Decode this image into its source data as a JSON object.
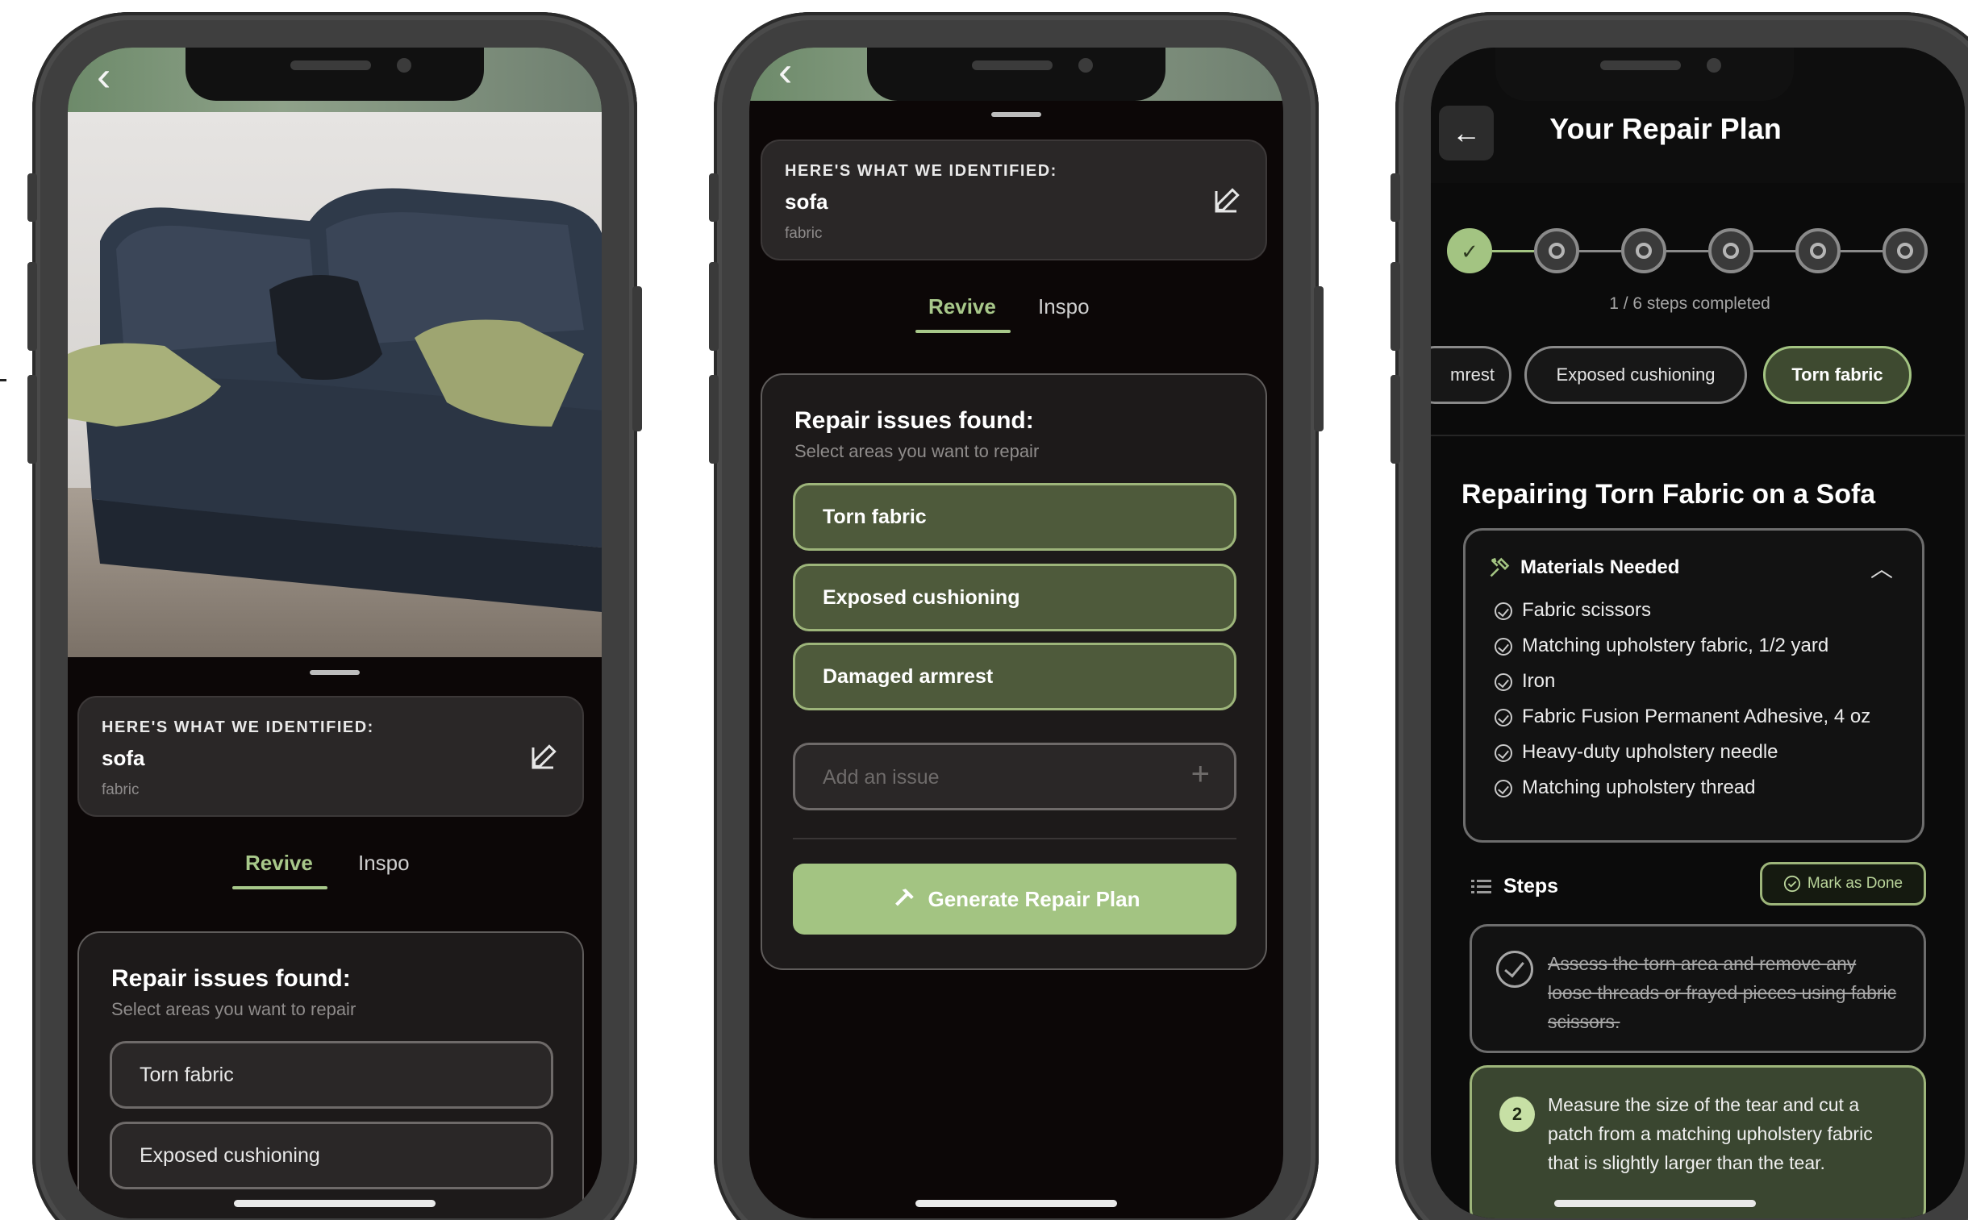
{
  "colors": {
    "accent": "#a3c482",
    "selected_chip": "#4e5a3b",
    "card": "#2a2727",
    "screen_bg": "#0c0707"
  },
  "phone1": {
    "photo_alt_icon": "back-chevron-icon",
    "identified": {
      "heading": "HERE'S WHAT WE IDENTIFIED:",
      "name": "sofa",
      "material": "fabric"
    },
    "tabs": [
      "Revive",
      "Inspo"
    ],
    "issues": {
      "title": "Repair issues found:",
      "subtitle": "Select areas you want to repair",
      "items": [
        "Torn fabric",
        "Exposed cushioning"
      ]
    }
  },
  "phone2": {
    "identified": {
      "heading": "HERE'S WHAT WE IDENTIFIED:",
      "name": "sofa",
      "material": "fabric"
    },
    "tabs": [
      "Revive",
      "Inspo"
    ],
    "issues": {
      "title": "Repair issues found:",
      "subtitle": "Select areas you want to repair",
      "items": [
        "Torn fabric",
        "Exposed cushioning",
        "Damaged armrest"
      ],
      "add_placeholder": "Add an issue",
      "add_symbol": "+"
    },
    "generate_button": "Generate Repair Plan"
  },
  "phone3": {
    "title": "Your Repair Plan",
    "back_symbol": "←",
    "progress": {
      "completed": 1,
      "total": 6,
      "label": "1 / 6 steps completed"
    },
    "chips": [
      "mrest",
      "Exposed cushioning",
      "Torn fabric"
    ],
    "active_chip": "Torn fabric",
    "repair_title": "Repairing Torn Fabric on a Sofa",
    "materials": {
      "heading": "Materials Needed",
      "items": [
        "Fabric scissors",
        "Matching upholstery fabric, 1/2 yard",
        "Iron",
        "Fabric Fusion Permanent Adhesive, 4 oz",
        "Heavy-duty upholstery needle",
        "Matching upholstery thread"
      ]
    },
    "steps_label": "Steps",
    "mark_done": "Mark as Done",
    "steps": [
      {
        "number": "1",
        "text": "Assess the torn area and remove any loose threads or frayed pieces using fabric scissors.",
        "done": true
      },
      {
        "number": "2",
        "text": "Measure the size of the tear and cut a patch from a matching upholstery fabric that is slightly larger than the tear.",
        "done": false
      }
    ]
  }
}
